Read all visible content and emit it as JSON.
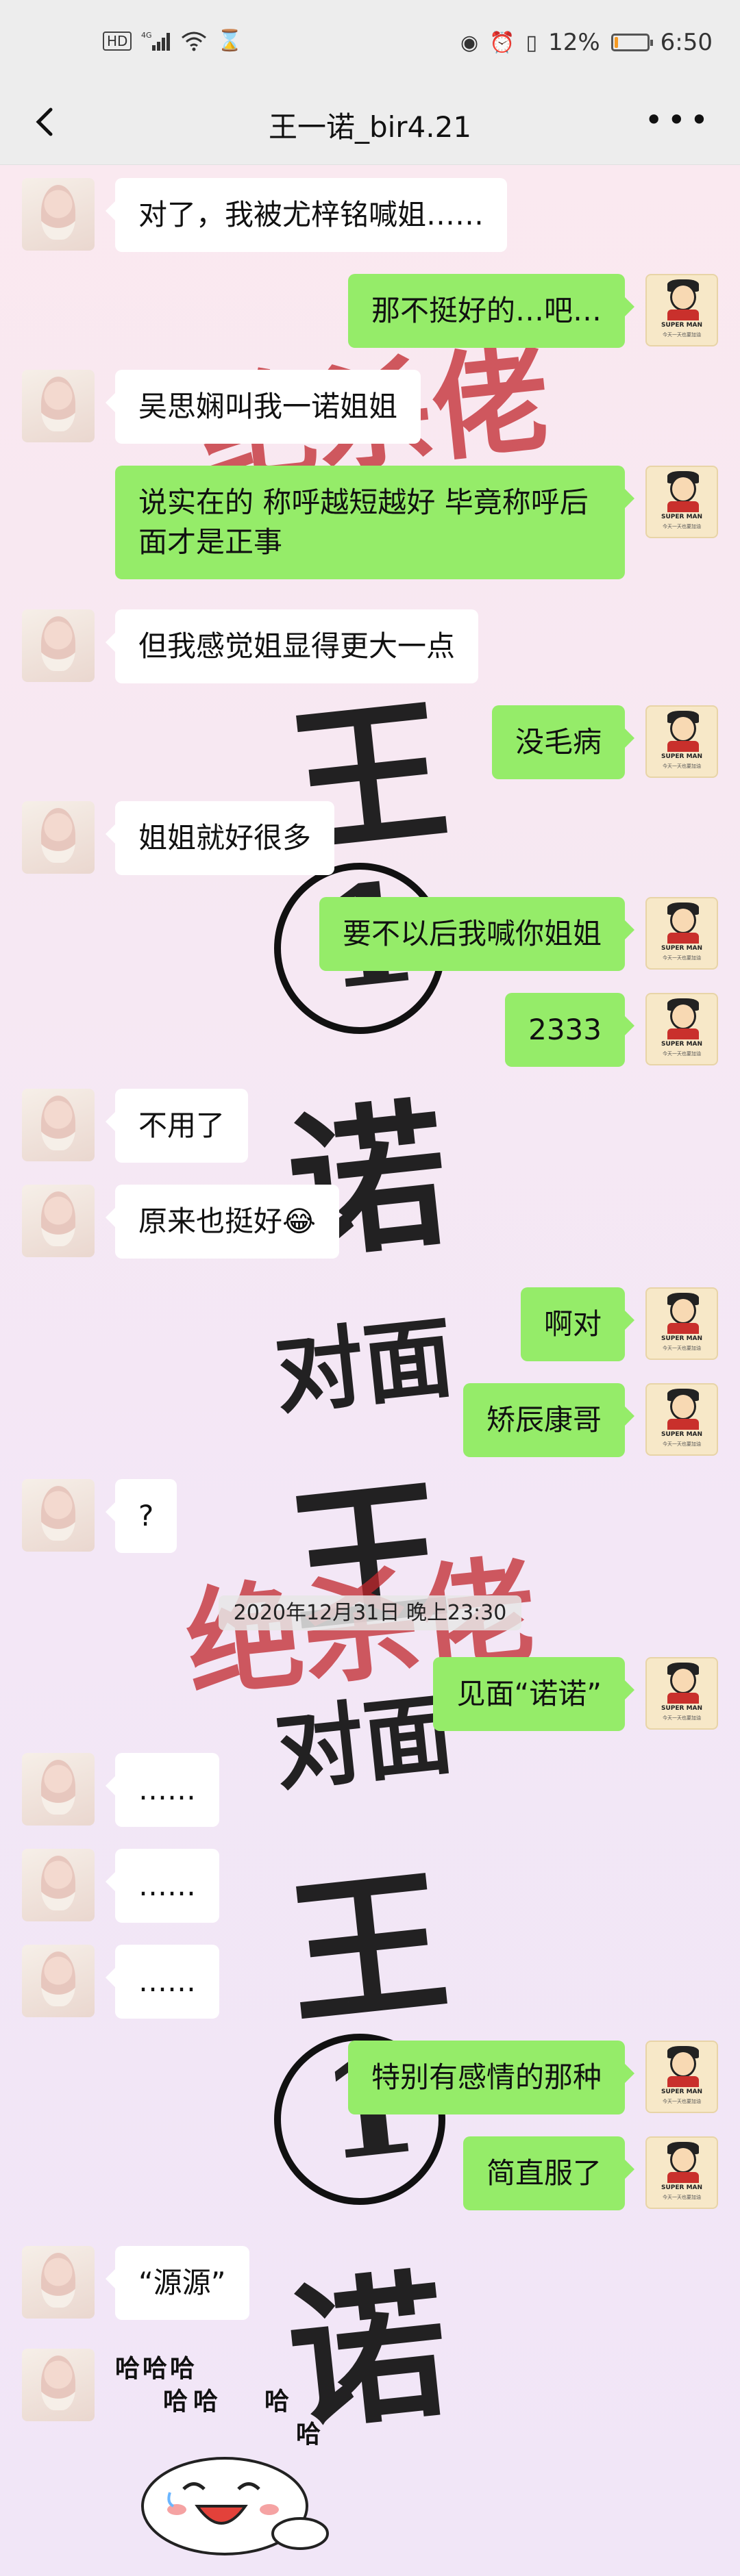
{
  "status_bar": {
    "left_icons": [
      "hd-icon",
      "4g-signal-icon",
      "wifi-icon",
      "hourglass-icon"
    ],
    "hd_label": "HD",
    "battery_percent": "12%",
    "battery_level": 0.12,
    "time": "6:50"
  },
  "header": {
    "title": "王一诺_bir4.21",
    "back_icon": "chevron-left-icon",
    "more_icon": "more-dots-icon"
  },
  "background_art": {
    "chars": [
      "绝杀佬",
      "王",
      "1",
      "诺",
      "对面",
      "王",
      "绝杀佬",
      "对面",
      "王",
      "1",
      "诺"
    ]
  },
  "messages": [
    {
      "side": "her",
      "text": "对了，我被尤梓铭喊姐……"
    },
    {
      "side": "me",
      "text": "那不挺好的…吧…"
    },
    {
      "side": "her",
      "text": "吴思娴叫我一诺姐姐"
    },
    {
      "side": "me",
      "text": "说实在的 称呼越短越好 毕竟称呼后面才是正事"
    },
    {
      "side": "her",
      "text": "但我感觉姐显得更大一点"
    },
    {
      "side": "me",
      "text": "没毛病"
    },
    {
      "side": "her",
      "text": "姐姐就好很多"
    },
    {
      "side": "me",
      "text": "要不以后我喊你姐姐"
    },
    {
      "side": "me",
      "text": "2333"
    },
    {
      "side": "her",
      "text": "不用了"
    },
    {
      "side": "her",
      "text": "原来也挺好😂"
    },
    {
      "side": "me",
      "text": "啊对"
    },
    {
      "side": "me",
      "text": "矫辰康哥"
    },
    {
      "side": "her",
      "text": "?"
    },
    {
      "side": "me",
      "text": "见面“诺诺”"
    },
    {
      "side": "her",
      "text": "……"
    },
    {
      "side": "her",
      "text": "……"
    },
    {
      "side": "her",
      "text": "……"
    },
    {
      "side": "me",
      "text": "特别有感情的那种"
    },
    {
      "side": "me",
      "text": "简直服了"
    },
    {
      "side": "her",
      "text": "“源源”"
    }
  ],
  "timestamp": "2020年12月31日 晚上23:30",
  "avatar_me": {
    "brand": "SUPER MAN",
    "sub": "今天一天也要加油"
  },
  "sticker": {
    "texts": [
      "哈",
      "哈",
      "哈",
      "哈",
      "哈",
      "哈",
      "哈",
      "哈"
    ],
    "name": "laughing-bun-sticker"
  }
}
